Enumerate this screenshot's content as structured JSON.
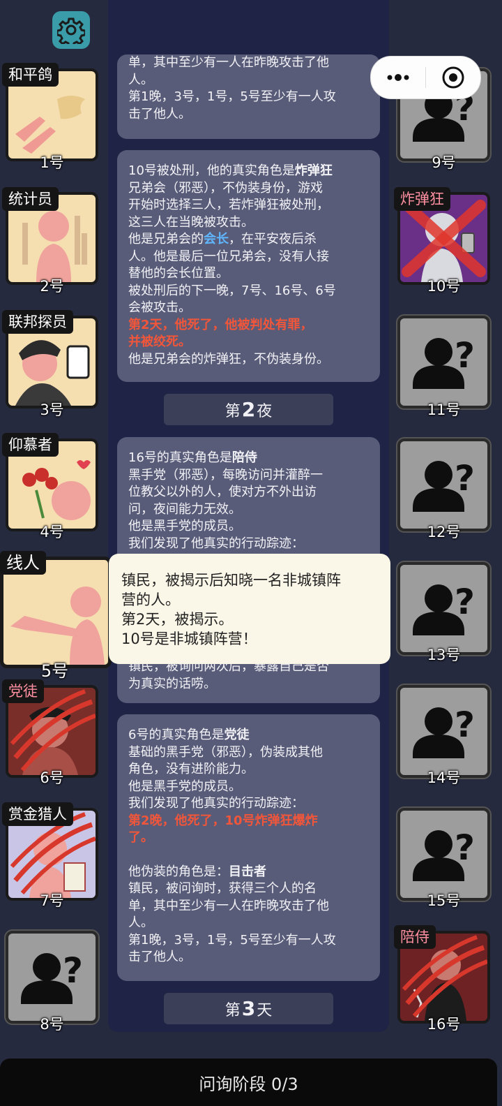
{
  "header": {
    "settings_icon": "gear-icon"
  },
  "capsule": {
    "more_icon": "more-dots-icon",
    "close_icon": "target-close-icon"
  },
  "left_players": [
    {
      "role": "和平鸽",
      "num": "1号"
    },
    {
      "role": "统计员",
      "num": "2号"
    },
    {
      "role": "联邦探员",
      "num": "3号"
    },
    {
      "role": "仰慕者",
      "num": "4号"
    },
    {
      "role": "线人",
      "num": "5号"
    },
    {
      "role": "党徒",
      "num": "6号"
    },
    {
      "role": "赏金猎人",
      "num": "7号"
    },
    {
      "role": "",
      "num": "8号"
    }
  ],
  "right_players": [
    {
      "role": "",
      "num": "9号"
    },
    {
      "role": "炸弹狂",
      "num": "10号"
    },
    {
      "role": "",
      "num": "11号"
    },
    {
      "role": "",
      "num": "12号"
    },
    {
      "role": "",
      "num": "13号"
    },
    {
      "role": "",
      "num": "14号"
    },
    {
      "role": "",
      "num": "15号"
    },
    {
      "role": "陪侍",
      "num": "16号"
    }
  ],
  "log": {
    "card0": {
      "l1": "单，其中至少有一人在昨晚攻击了他",
      "l2": "人。",
      "l3": "第1晚，3号，1号，5号至少有一人攻",
      "l4": "击了他人。"
    },
    "card1": {
      "t1": "10号被处刑，他的真实角色是",
      "t1b": "炸弹狂",
      "t2": "兄弟会（邪恶），不伪装身份，游戏",
      "t3": "开始时选择三人，若炸弹狂被处刑，",
      "t4": "这三人在当晚被攻击。",
      "t5a": "他是兄弟会的",
      "t5b": "会长",
      "t5c": "，在平安夜后杀",
      "t6": "人。他是最后一位兄弟会，没有人接",
      "t7": "替他的会长位置。",
      "t8": "被处刑后的下一晚，7号、16号、6号",
      "t9": "会被攻击。",
      "t10": "第2天，他死了，他被判处有罪，",
      "t11": "并被绞死。",
      "t12": "他是兄弟会的炸弹狂，不伪装身份。"
    },
    "divider1": {
      "pre": "第",
      "num": "2",
      "post": "夜"
    },
    "card2": {
      "t1": "16号的真实角色是",
      "t1b": "陪侍",
      "t2": "黑手党（邪恶），每晚访问并灌醉一",
      "t3": "位教父以外的人，使对方不外出访",
      "t4": "问，夜间能力无效。",
      "t5": "他是黑手党的成员。",
      "t6": "我们发现了他真实的行动踪迹：",
      "t7": "镇民，被询问两次后，暴露自己是否",
      "t8": "为真实的话唠。"
    },
    "card3": {
      "t1": "6号的真实角色是",
      "t1b": "党徒",
      "t2": "基础的黑手党（邪恶），伪装成其他",
      "t3": "角色，没有进阶能力。",
      "t4": "他是黑手党的成员。",
      "t5": "我们发现了他真实的行动踪迹：",
      "t6": "第2晚，他死了，10号炸弹狂爆炸",
      "t7": "了。",
      "t8": "他伪装的角色是：",
      "t8b": "目击者",
      "t9": "镇民，被问询时，获得三个人的名",
      "t10": "单，其中至少有一人在昨晚攻击了他",
      "t11": "人。",
      "t12": "第1晚，3号，1号，5号至少有一人攻",
      "t13": "击了他人。"
    },
    "divider2": {
      "pre": "第",
      "num": "3",
      "post": "天"
    }
  },
  "tooltip": {
    "l1": "镇民，被揭示后知晓一名非城镇阵",
    "l2": "营的人。",
    "l3": "第2天，被揭示。",
    "l4": "10号是非城镇阵营！"
  },
  "bottom": {
    "phase": "问询阶段 0/3"
  },
  "colors": {
    "accent_red": "#f2563a",
    "accent_blue": "#5fb6ff",
    "panel": "#585c79",
    "background": "#262a3e"
  }
}
